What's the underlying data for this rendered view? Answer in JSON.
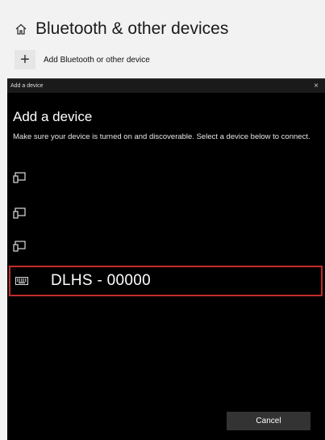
{
  "settings": {
    "title": "Bluetooth & other devices",
    "add_label": "Add Bluetooth or other device",
    "plus": "+"
  },
  "dialog": {
    "titlebar": "Add a device",
    "close": "×",
    "heading": "Add a device",
    "description": "Make sure your device is turned on and discoverable. Select a device below to connect.",
    "devices": [
      {
        "icon": "display-device-icon"
      },
      {
        "icon": "display-device-icon"
      },
      {
        "icon": "display-device-icon"
      }
    ],
    "selected_device": {
      "icon": "keyboard-icon",
      "name": "DLHS - 00000"
    },
    "cancel_label": "Cancel"
  },
  "colors": {
    "selection_border": "#c42b2b",
    "dialog_bg": "#000000",
    "page_bg": "#f2f2f2"
  }
}
